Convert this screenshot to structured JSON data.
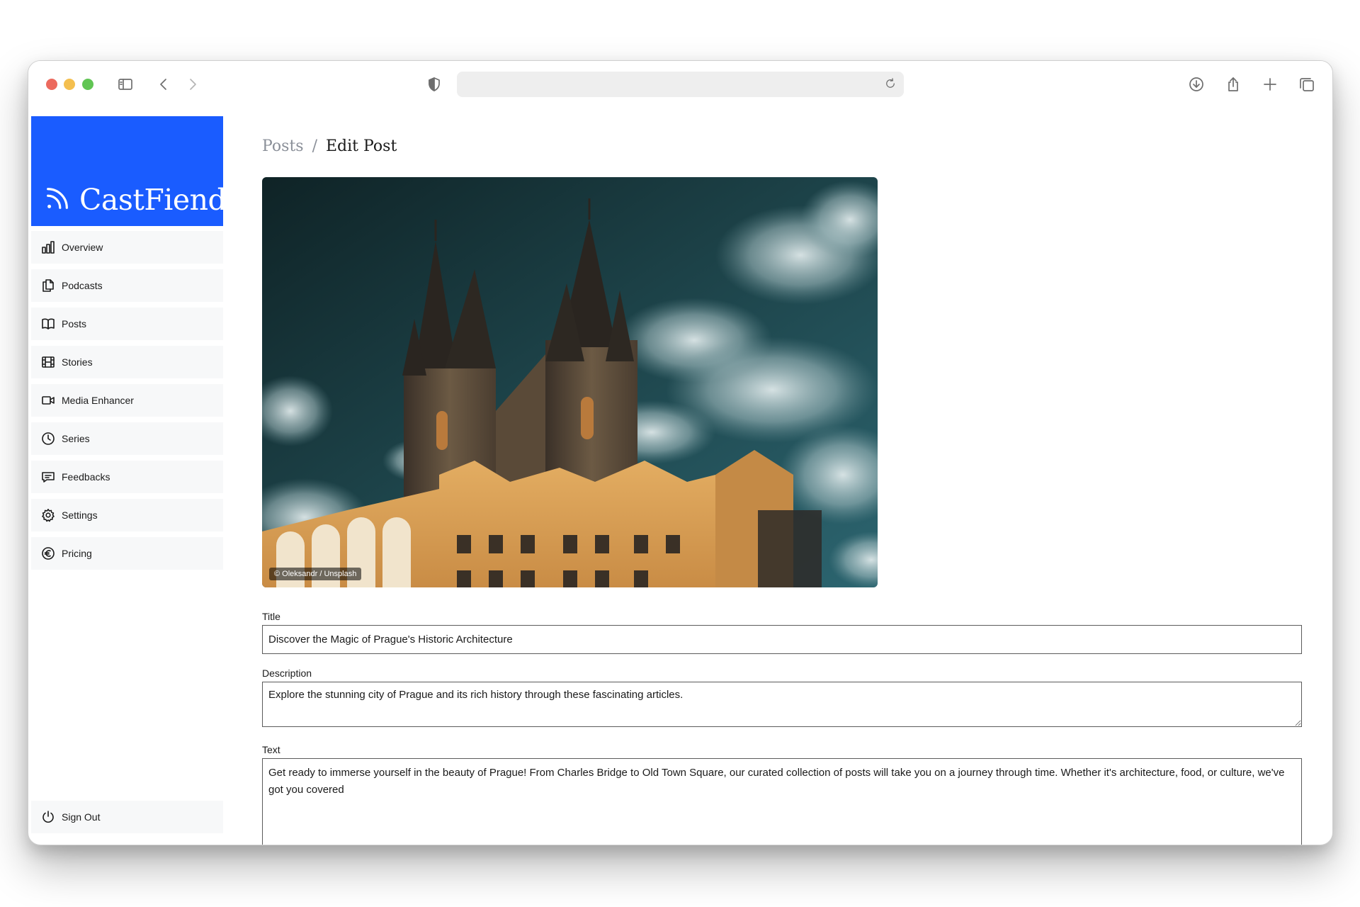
{
  "browser": {
    "icons": [
      "sidebar-toggle-icon",
      "back-icon",
      "forward-icon",
      "shield-icon",
      "reload-icon",
      "download-icon",
      "share-icon",
      "new-tab-icon",
      "tabs-overview-icon"
    ],
    "address_value": ""
  },
  "brand": {
    "name": "CastFiend",
    "icon": "rss-icon",
    "color": "#1a5cff"
  },
  "sidebar": {
    "items": [
      {
        "label": "Overview",
        "icon": "bar-chart-icon"
      },
      {
        "label": "Podcasts",
        "icon": "documents-icon"
      },
      {
        "label": "Posts",
        "icon": "book-icon"
      },
      {
        "label": "Stories",
        "icon": "film-icon"
      },
      {
        "label": "Media Enhancer",
        "icon": "video-camera-icon"
      },
      {
        "label": "Series",
        "icon": "clock-icon"
      },
      {
        "label": "Feedbacks",
        "icon": "message-icon"
      },
      {
        "label": "Settings",
        "icon": "gear-icon"
      },
      {
        "label": "Pricing",
        "icon": "euro-icon"
      }
    ],
    "sign_out": {
      "label": "Sign Out",
      "icon": "power-icon"
    }
  },
  "breadcrumb": {
    "parent": "Posts",
    "separator": "/",
    "current": "Edit Post"
  },
  "hero": {
    "credit": "© Oleksandr / Unsplash"
  },
  "form": {
    "title_label": "Title",
    "title_value": "Discover the Magic of Prague's Historic Architecture",
    "description_label": "Description",
    "description_value": "Explore the stunning city of Prague and its rich history through these fascinating articles.",
    "text_label": "Text",
    "text_value": "Get ready to immerse yourself in the beauty of Prague! From Charles Bridge to Old Town Square, our curated collection of posts will take you on a journey through time. Whether it's architecture, food, or culture, we've got you covered"
  }
}
